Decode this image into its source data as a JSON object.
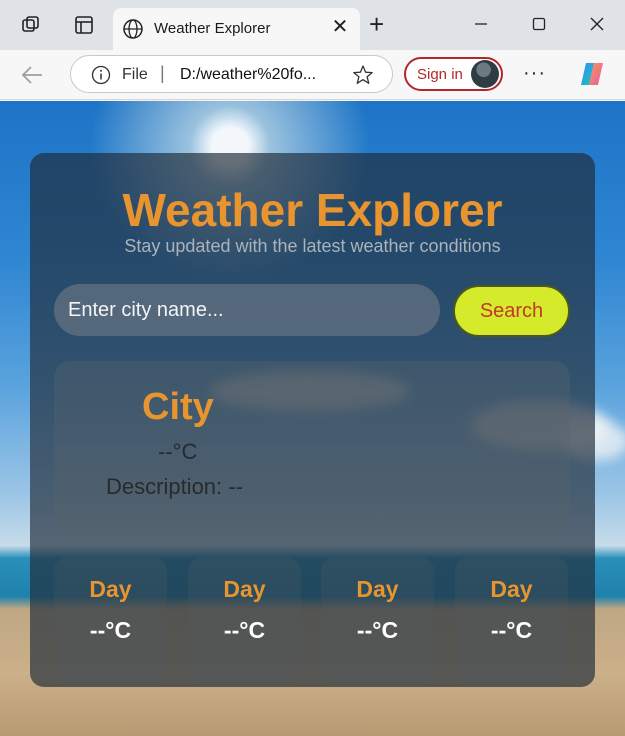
{
  "browser": {
    "tab_title": "Weather Explorer",
    "address_scheme": "File",
    "address_url": "D:/weather%20fo...",
    "sign_in_label": "Sign in",
    "more_label": "···"
  },
  "app": {
    "title": "Weather Explorer",
    "subtitle": "Stay updated with the latest weather conditions",
    "search": {
      "placeholder": "Enter city name...",
      "value": "",
      "button_label": "Search"
    },
    "current": {
      "city": "City",
      "temperature": "--°C",
      "description": "Description: --"
    },
    "forecast": [
      {
        "day": "Day",
        "temp": "--°C"
      },
      {
        "day": "Day",
        "temp": "--°C"
      },
      {
        "day": "Day",
        "temp": "--°C"
      },
      {
        "day": "Day",
        "temp": "--°C"
      }
    ]
  },
  "colors": {
    "accent_orange": "#e8942f",
    "search_button": "#d4ea2a",
    "search_button_text": "#c0392b",
    "signin_border": "#b5262c"
  },
  "icons": [
    "workspaces-icon",
    "tab-actions-icon",
    "globe-icon",
    "close-icon",
    "plus-icon",
    "minimize-icon",
    "maximize-icon",
    "window-close-icon",
    "back-arrow-icon",
    "info-icon",
    "star-icon",
    "more-icon",
    "copilot-icon"
  ]
}
